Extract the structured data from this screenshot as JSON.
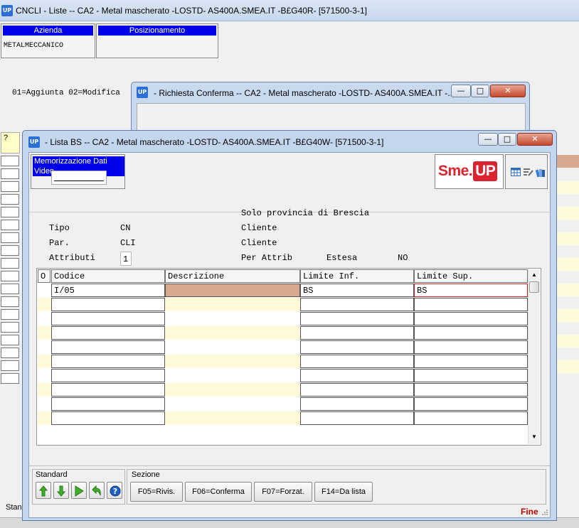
{
  "main_window": {
    "title": "CNCLI -  Liste -- CA2 - Metal mascherato -LOSTD- AS400A.SMEA.IT -B£G40R- [571500-3-1]",
    "app_icon_text": "UP"
  },
  "header_boxes": {
    "azienda": {
      "caption": "Azienda",
      "value": "METALMECCANICO"
    },
    "posizionamento": {
      "caption": "Posizionamento"
    }
  },
  "legend": "01=Aggiunta 02=Modifica",
  "bg_grid": {
    "question_mark": "?"
  },
  "bg_status": "Stan",
  "confirm_window": {
    "title": "-  Richiesta Conferma -- CA2 - Metal mascherato -LOSTD- AS400A.SMEA.IT -...",
    "app_icon_text": "UP"
  },
  "lista_window": {
    "title": "-  Lista BS -- CA2 - Metal mascherato -LOSTD- AS400A.SMEA.IT -B£G40W- [571500-3-1]",
    "app_icon_text": "UP",
    "memo_caption": "Memorizzazione Dati Video",
    "logo": {
      "text": "Sme.",
      "badge": "UP"
    },
    "info_line": "Solo provincia di Brescia",
    "fields": {
      "tipo_label": "Tipo",
      "tipo_value": "CN",
      "tipo_desc": "Cliente",
      "par_label": "Par.",
      "par_value": "CLI",
      "par_desc": "Cliente",
      "attr_label": "Attributi",
      "attr_value": "1",
      "per_attrib_label": "Per Attrib",
      "estesa_label": "Estesa",
      "estesa_value": "NO"
    },
    "table": {
      "headers": [
        "O",
        "Codice",
        "Descrizione",
        "Limite Inf.",
        "Limite Sup."
      ],
      "rows": [
        [
          "",
          "I/05",
          "",
          "BS",
          "BS"
        ],
        [
          "",
          "",
          "",
          "",
          ""
        ],
        [
          "",
          "",
          "",
          "",
          ""
        ],
        [
          "",
          "",
          "",
          "",
          ""
        ],
        [
          "",
          "",
          "",
          "",
          ""
        ],
        [
          "",
          "",
          "",
          "",
          ""
        ],
        [
          "",
          "",
          "",
          "",
          ""
        ],
        [
          "",
          "",
          "",
          "",
          ""
        ],
        [
          "",
          "",
          "",
          "",
          ""
        ],
        [
          "",
          "",
          "",
          "",
          ""
        ]
      ]
    },
    "toolbar": {
      "standard_label": "Standard",
      "sezione_label": "Sezione",
      "fkeys": [
        "F05=Rivis.",
        "F06=Conferma",
        "F07=Forzat.",
        "F14=Da lista"
      ]
    },
    "status": "Fine"
  },
  "colors": {
    "caption_blue": "#0000e8",
    "row_highlight": "#d9a98f",
    "row_band_yellow": "#fffad8",
    "logo_red": "#d9232e",
    "fine_red": "#c00000"
  }
}
